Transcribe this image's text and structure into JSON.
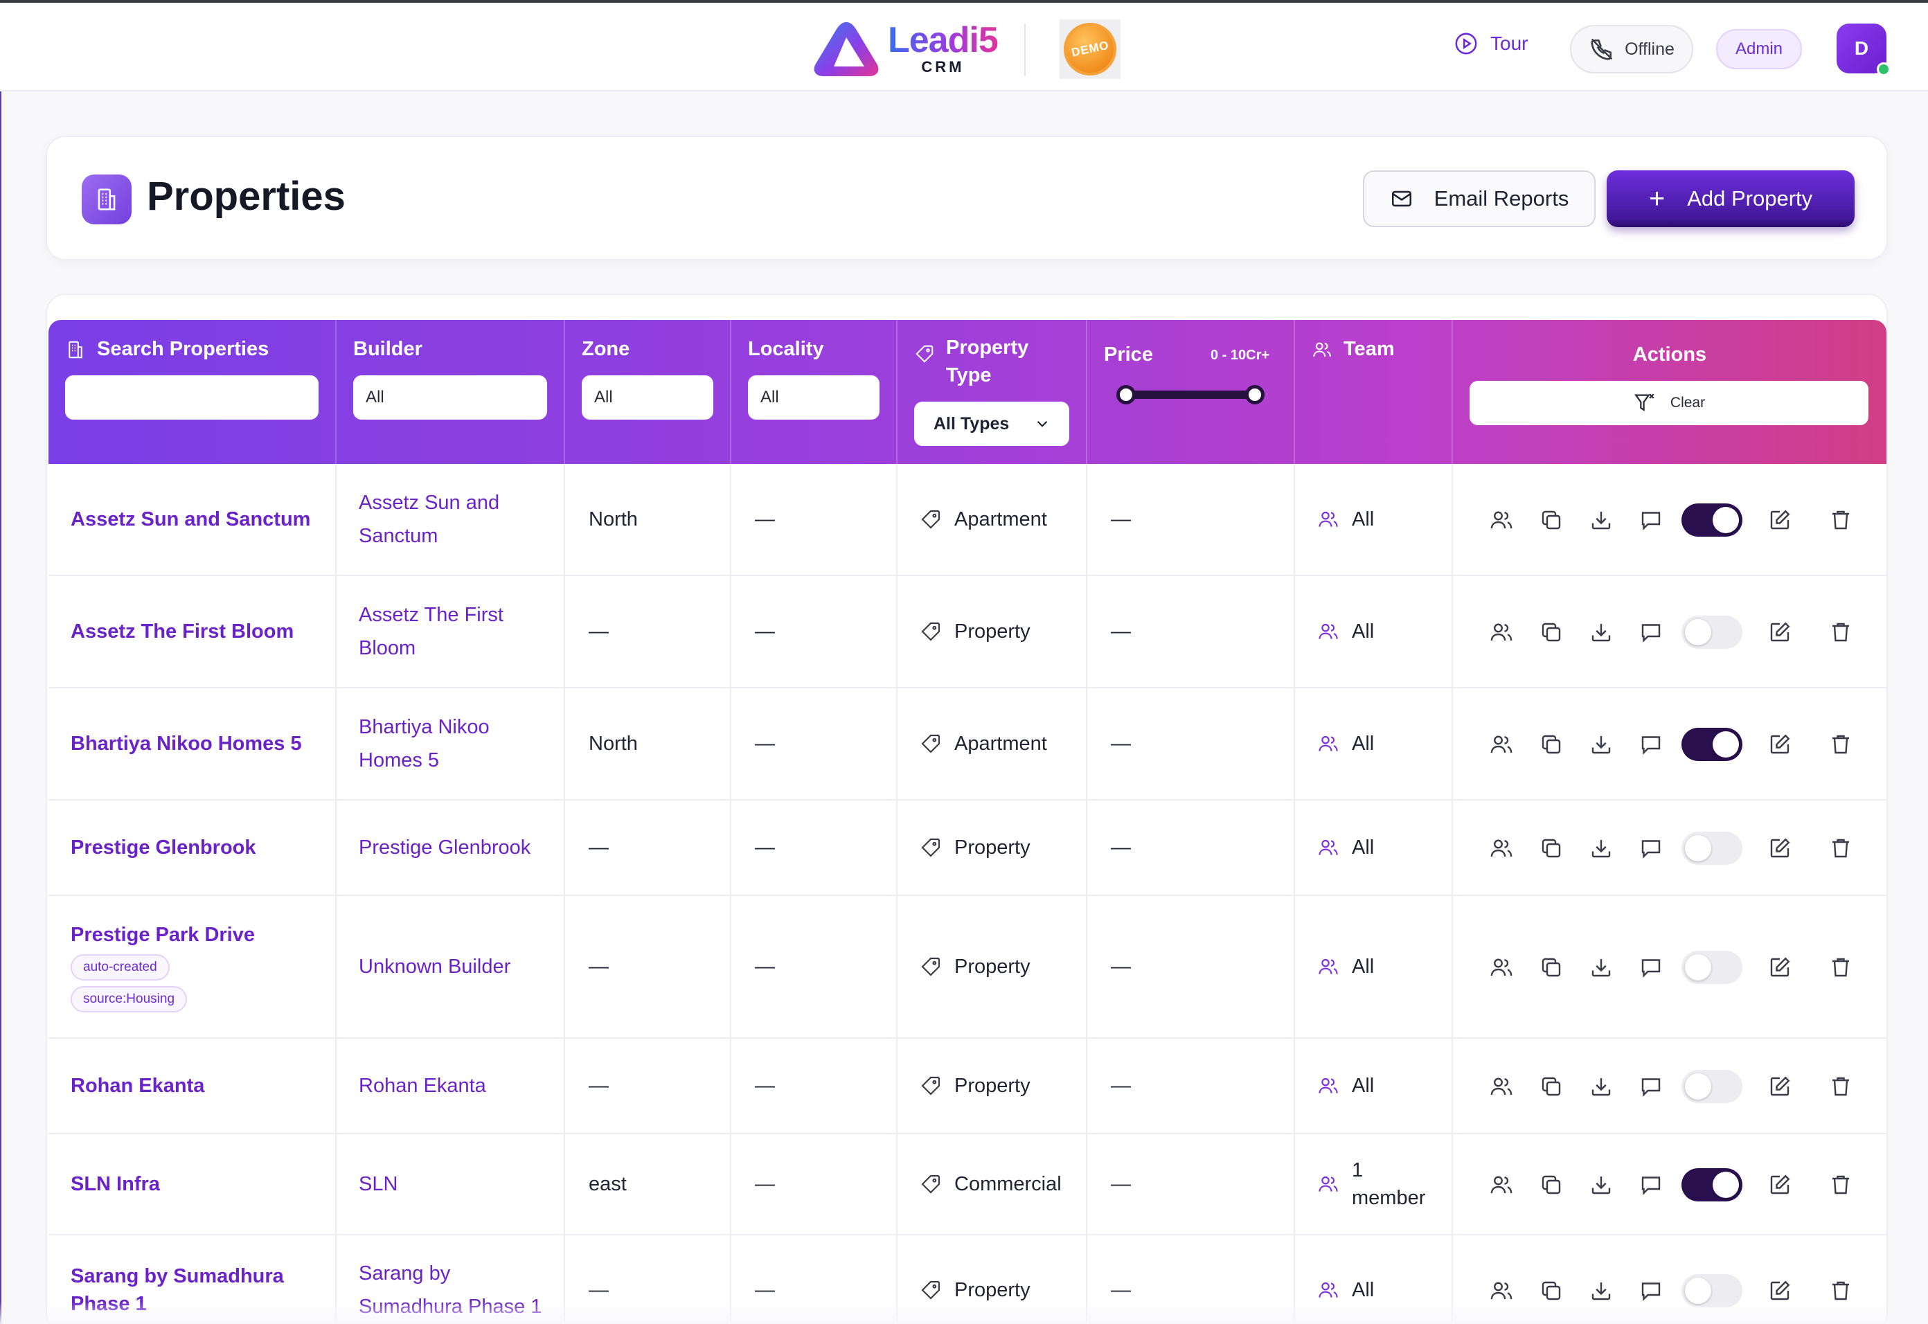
{
  "topbar": {
    "logo_name": "Leadi5",
    "logo_sub": "CRM",
    "demo_label": "DEMO",
    "tour_label": "Tour",
    "offline_label": "Offline",
    "admin_label": "Admin",
    "avatar_initial": "D"
  },
  "header": {
    "title": "Properties",
    "email_reports_label": "Email Reports",
    "add_property_label": "Add Property"
  },
  "filters": {
    "search_label": "Search Properties",
    "search_value": "",
    "builder_label": "Builder",
    "builder_value": "All",
    "zone_label": "Zone",
    "zone_value": "All",
    "locality_label": "Locality",
    "locality_value": "All",
    "property_type_label_1": "Property",
    "property_type_label_2": "Type",
    "property_type_value": "All Types",
    "price_label": "Price",
    "price_range": "0 - 10Cr+",
    "price_min_fraction": 0,
    "price_max_fraction": 1,
    "team_label": "Team",
    "actions_label": "Actions",
    "clear_label": "Clear"
  },
  "rows": [
    {
      "name": "Assetz Sun and Sanctum",
      "tags": [],
      "builder_1": "Assetz Sun and",
      "builder_2": "Sanctum",
      "zone": "North",
      "locality": "—",
      "type": "Apartment",
      "price": "—",
      "team_1": "All",
      "team_2": "",
      "active": true
    },
    {
      "name": "Assetz The First Bloom",
      "tags": [],
      "builder_1": "Assetz The First",
      "builder_2": "Bloom",
      "zone": "—",
      "locality": "—",
      "type": "Property",
      "price": "—",
      "team_1": "All",
      "team_2": "",
      "active": false
    },
    {
      "name": "Bhartiya Nikoo Homes 5",
      "tags": [],
      "builder_1": "Bhartiya Nikoo",
      "builder_2": "Homes 5",
      "zone": "North",
      "locality": "—",
      "type": "Apartment",
      "price": "—",
      "team_1": "All",
      "team_2": "",
      "active": true
    },
    {
      "name": "Prestige Glenbrook",
      "tags": [],
      "builder_1": "Prestige Glenbrook",
      "builder_2": "",
      "zone": "—",
      "locality": "—",
      "type": "Property",
      "price": "—",
      "team_1": "All",
      "team_2": "",
      "active": false
    },
    {
      "name": "Prestige Park Drive",
      "tags": [
        "auto-created",
        "source:Housing"
      ],
      "builder_1": "Unknown Builder",
      "builder_2": "",
      "zone": "—",
      "locality": "—",
      "type": "Property",
      "price": "—",
      "team_1": "All",
      "team_2": "",
      "active": false
    },
    {
      "name": "Rohan Ekanta",
      "tags": [],
      "builder_1": "Rohan Ekanta",
      "builder_2": "",
      "zone": "—",
      "locality": "—",
      "type": "Property",
      "price": "—",
      "team_1": "All",
      "team_2": "",
      "active": false
    },
    {
      "name": "SLN Infra",
      "tags": [],
      "builder_1": "SLN",
      "builder_2": "",
      "zone": "east",
      "locality": "—",
      "type": "Commercial",
      "price": "—",
      "team_1": "1",
      "team_2": "member",
      "active": true
    },
    {
      "name_1": "Sarang by Sumadhura",
      "name_2": "Phase 1",
      "name": "",
      "tags": [],
      "builder_1": "Sarang by",
      "builder_2": "Sumadhura Phase 1",
      "zone": "—",
      "locality": "—",
      "type": "Property",
      "price": "—",
      "team_1": "All",
      "team_2": "",
      "active": false
    }
  ],
  "colors": {
    "accent": "#6a22c9",
    "toggle_on": "#2a0f4e",
    "header_gradient_start": "#7a3fe6",
    "header_gradient_end": "#d23e86"
  },
  "icons": {
    "row_actions": [
      "users-icon",
      "copy-icon",
      "download-icon",
      "comment-icon",
      "status-toggle",
      "edit-icon",
      "trash-icon"
    ]
  }
}
